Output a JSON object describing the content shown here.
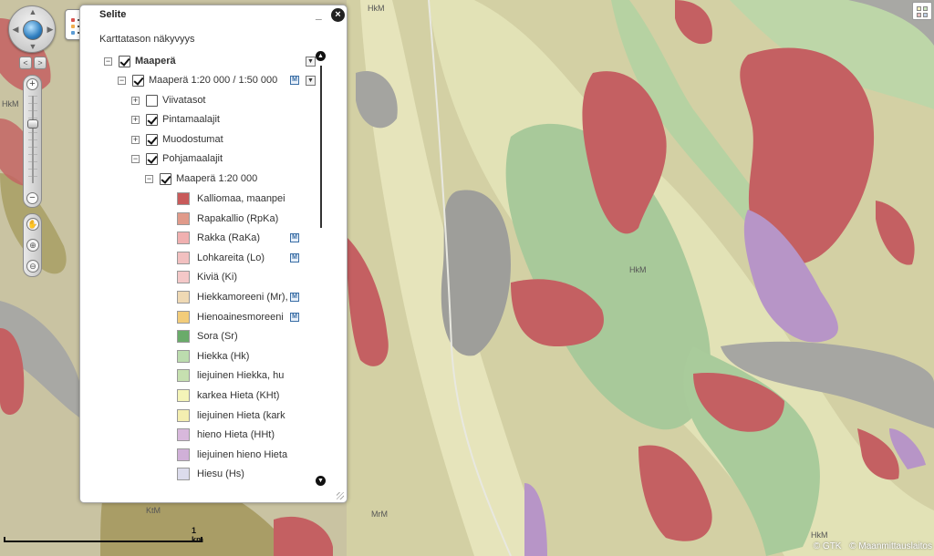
{
  "map": {
    "labels": [
      "HkM",
      "HkM",
      "HkM",
      "MrM",
      "HkM",
      "KtM"
    ],
    "scale_label": "1 km",
    "copyright": [
      "© GTK",
      "© Maanmittauslaitos"
    ]
  },
  "panel": {
    "title": "Selite",
    "visibility_label": "Karttatason näkyvyys",
    "minimize_glyph": "_",
    "close_glyph": "×"
  },
  "tree": {
    "root": {
      "label": "Maaperä",
      "checked": true,
      "expander": "−"
    },
    "group": {
      "label": "Maaperä 1:20 000 / 1:50 000",
      "checked": true,
      "expander": "−",
      "badge": "M"
    },
    "children": [
      {
        "label": "Viivatasot",
        "checked": false,
        "expander": "+"
      },
      {
        "label": "Pintamaalajit",
        "checked": true,
        "expander": "+"
      },
      {
        "label": "Muodostumat",
        "checked": true,
        "expander": "+"
      },
      {
        "label": "Pohjamaalajit",
        "checked": true,
        "expander": "−"
      }
    ],
    "subgroup": {
      "label": "Maaperä 1:20 000",
      "checked": true,
      "expander": "−"
    },
    "legend": [
      {
        "label": "Kalliomaa, maanpei",
        "color": "#c85a5a",
        "badge": ""
      },
      {
        "label": "Rapakallio (RpKa)",
        "color": "#e09a8a",
        "badge": ""
      },
      {
        "label": "Rakka (RaKa)",
        "color": "#f0b0b0",
        "badge": "M"
      },
      {
        "label": "Lohkareita (Lo)",
        "color": "#f2c0c0",
        "badge": "M"
      },
      {
        "label": "Kiviä (Ki)",
        "color": "#f4c8c8",
        "badge": ""
      },
      {
        "label": "Hiekkamoreeni (Mr),",
        "color": "#efd9b4",
        "badge": "M"
      },
      {
        "label": "Hienoainesmoreeni",
        "color": "#f2cc7a",
        "badge": "M"
      },
      {
        "label": "Sora (Sr)",
        "color": "#6aab6a",
        "badge": ""
      },
      {
        "label": "Hiekka (Hk)",
        "color": "#bcdcae",
        "badge": ""
      },
      {
        "label": "liejuinen Hiekka, hu",
        "color": "#c6e0b0",
        "badge": ""
      },
      {
        "label": "karkea Hieta (KHt)",
        "color": "#f4f4b8",
        "badge": ""
      },
      {
        "label": "liejuinen Hieta (kark",
        "color": "#f4eeb0",
        "badge": ""
      },
      {
        "label": "hieno Hieta (HHt)",
        "color": "#d8b8dc",
        "badge": ""
      },
      {
        "label": "liejuinen hieno Hieta",
        "color": "#d0b0d8",
        "badge": ""
      },
      {
        "label": "Hiesu (Hs)",
        "color": "#dcdcec",
        "badge": ""
      }
    ]
  },
  "colors": {
    "bedrock": "#c85a5a",
    "sand": "#bcdcae",
    "till": "#d7d3a6",
    "fine_sand": "#e7e7b8",
    "water": "#9c9c9c",
    "peat": "#b1a572",
    "silt": "#b995c9"
  }
}
